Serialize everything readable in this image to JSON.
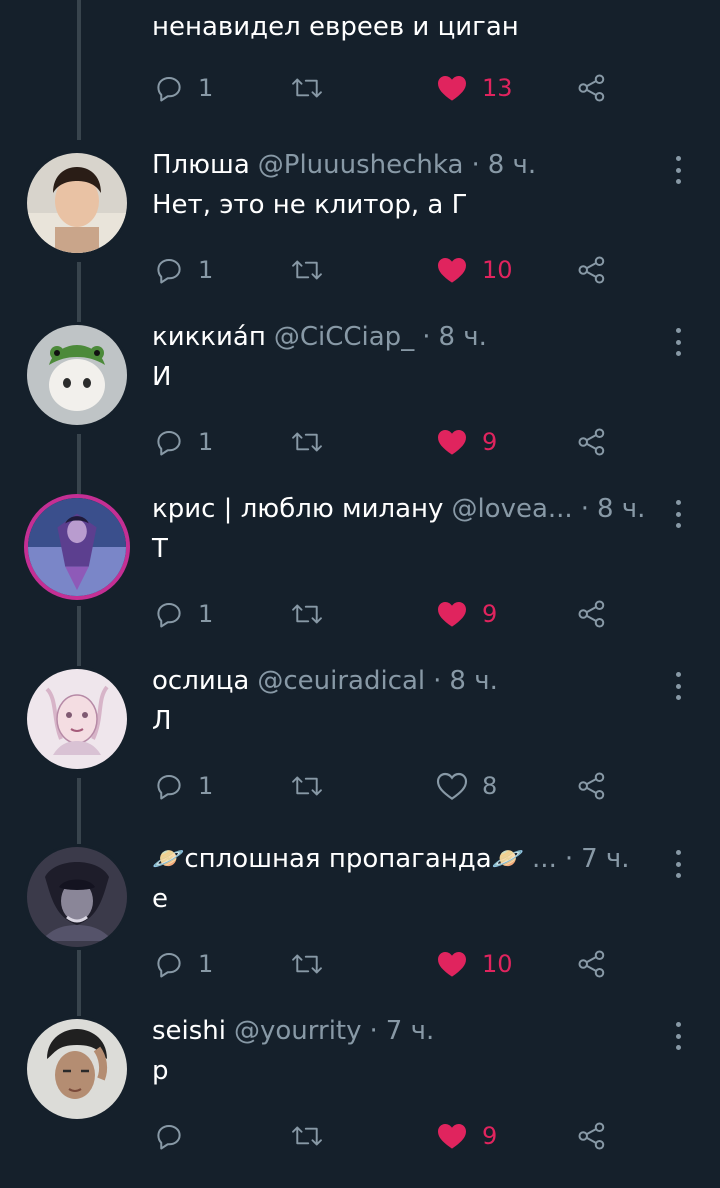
{
  "top_tweet_text": "ненавидел евреев и циган",
  "top_actions": {
    "replies": "1",
    "likes": "13",
    "liked": true
  },
  "colors": {
    "background": "#15202b",
    "secondary_text": "#8899a6",
    "like": "#e0245e",
    "thread_line": "#38444d"
  },
  "tweets": [
    {
      "name": "Плюша",
      "handle": "@Pluuushechka",
      "time": "8 ч.",
      "text": "Нет, это не клитор, а Г",
      "replies": "1",
      "likes": "10",
      "liked": true
    },
    {
      "name": "киккиа́п",
      "handle": "@CiCCiap_",
      "time": "8 ч.",
      "text": "И",
      "replies": "1",
      "likes": "9",
      "liked": true
    },
    {
      "name": "крис | люблю милану",
      "handle": "@lovea...",
      "time": "8 ч.",
      "text": "Т",
      "replies": "1",
      "likes": "9",
      "liked": true
    },
    {
      "name": "ослица",
      "handle": "@ceuiradical",
      "time": "8 ч.",
      "text": "Л",
      "replies": "1",
      "likes": "8",
      "liked": false
    },
    {
      "name": "🪐сплошная пропаганда🪐",
      "handle": "...",
      "time": "7 ч.",
      "text": "е",
      "replies": "1",
      "likes": "10",
      "liked": true
    },
    {
      "name": "seishi",
      "handle": "@yourrity",
      "time": "7 ч.",
      "text": "р",
      "replies": "",
      "likes": "9",
      "liked": true
    }
  ],
  "icons": [
    "reply-icon",
    "retweet-icon",
    "heart-icon",
    "share-icon",
    "more-options-icon"
  ]
}
